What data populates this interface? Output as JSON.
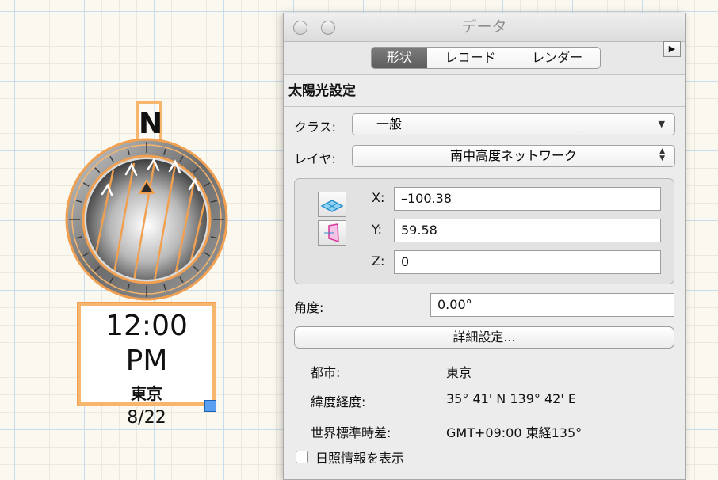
{
  "canvas": {
    "north_label": "N",
    "time": "12:00 PM",
    "city": "東京",
    "date": "8/22",
    "accent_color": "#f6b66e"
  },
  "palette": {
    "window_title": "データ",
    "tabs": [
      {
        "label": "形状",
        "active": true
      },
      {
        "label": "レコード",
        "active": false
      },
      {
        "label": "レンダー",
        "active": false
      }
    ],
    "expand_icon": "triangle-right-icon",
    "section_title": "太陽光設定",
    "class": {
      "label": "クラス:",
      "value": "一般"
    },
    "layer": {
      "label": "レイヤ:",
      "value": "南中高度ネットワーク"
    },
    "coords": {
      "x_label": "X:",
      "x_value": "–100.38",
      "y_label": "Y:",
      "y_value": "59.58",
      "z_label": "Z:",
      "z_value": "0",
      "icons": [
        "plane-icon",
        "perspective-plane-icon"
      ]
    },
    "angle": {
      "label": "角度:",
      "value": "0.00°"
    },
    "detail_button": "詳細設定...",
    "info": [
      {
        "label": "都市:",
        "value": "東京"
      },
      {
        "label": "緯度経度:",
        "value": "35° 41'  N 139° 42'  E"
      },
      {
        "label": "世界標準時差:",
        "value": "GMT+09:00 東経135°"
      }
    ],
    "show_sun_info": {
      "label": "日照情報を表示",
      "checked": false
    }
  }
}
